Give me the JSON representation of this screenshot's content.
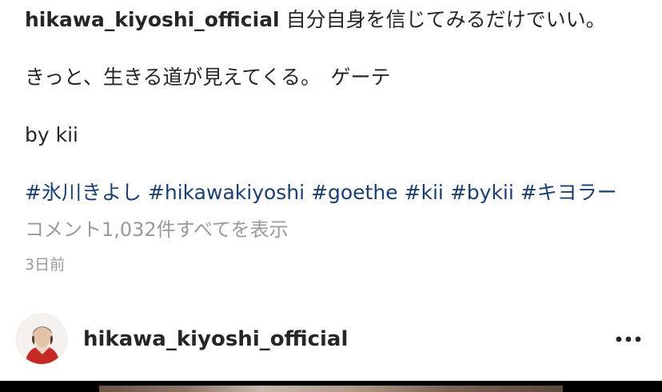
{
  "caption": {
    "username": "hikawa_kiyoshi_official",
    "line1": "自分自身を信じてみるだけでいい。",
    "line2": "きっと、生きる道が見えてくる。　ゲーテ",
    "line3": "by kii",
    "hashtags": [
      "#氷川きよし",
      "#hikawakiyoshi",
      "#goethe",
      "#kii",
      "#bykii",
      "#キヨラー"
    ]
  },
  "comments_link": "コメント1,032件すべてを表示",
  "timestamp": "3日前",
  "next_post": {
    "username": "hikawa_kiyoshi_official",
    "avatar_icon": "profile-avatar",
    "more_icon": "more-horizontal-icon"
  },
  "colors": {
    "text": "#262626",
    "hashtag": "#1a3f73",
    "secondary": "#9a9a9a"
  }
}
